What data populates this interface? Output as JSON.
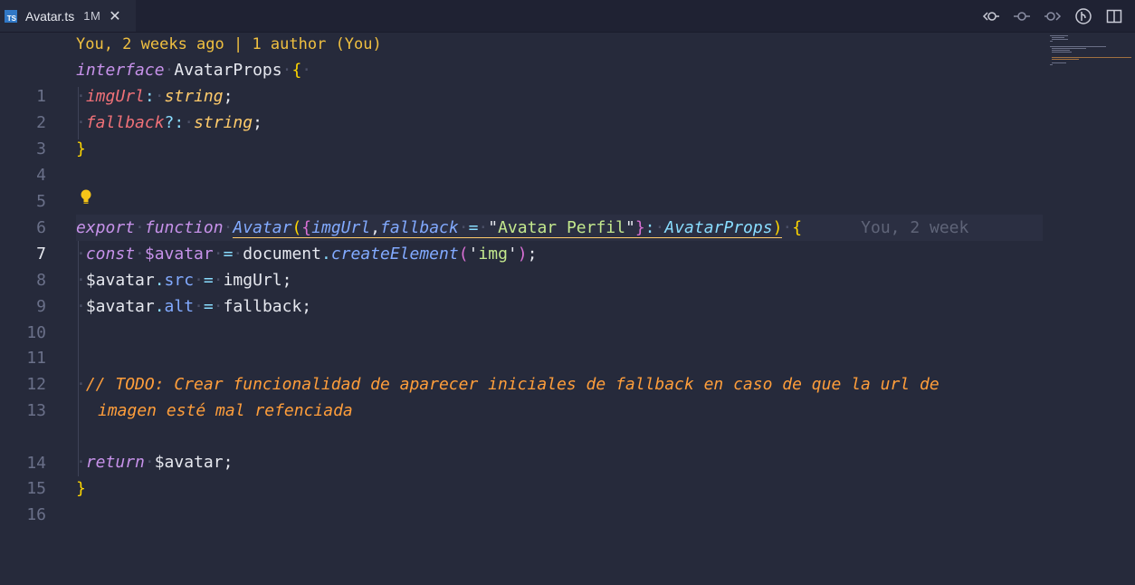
{
  "tab": {
    "icon": "typescript-file-icon",
    "icon_text": "TS",
    "filename": "Avatar.ts",
    "status": "1M",
    "close": "✕"
  },
  "toolbar": {
    "icons": [
      "git-timeline-back-icon",
      "git-commit-icon",
      "git-timeline-forward-icon",
      "git-branch-graph-icon",
      "split-editor-icon"
    ]
  },
  "codelens": "You, 2 weeks ago | 1 author (You)",
  "line_numbers": [
    "1",
    "2",
    "3",
    "4",
    "5",
    "6",
    "7",
    "8",
    "9",
    "10",
    "11",
    "12",
    "13",
    "",
    "14",
    "15",
    "16"
  ],
  "active_line": "7",
  "code": {
    "l1": [
      "interface",
      "AvatarProps",
      "{"
    ],
    "l2": [
      "imgUrl",
      ":",
      "string",
      ";"
    ],
    "l3": [
      "fallback",
      "?:",
      "string",
      ";"
    ],
    "l4": [
      "}"
    ],
    "l7": [
      "export",
      "function",
      "Avatar",
      "(",
      "{",
      "imgUrl",
      ",",
      "fallback",
      "=",
      "\"",
      "Avatar Perfil",
      "\"",
      "}",
      ":",
      "AvatarProps",
      ")",
      "{"
    ],
    "l7_blame": "You, 2 week",
    "l8": [
      "const",
      "$avatar",
      "=",
      "document",
      ".",
      "createElement",
      "(",
      "'",
      "img",
      "'",
      ")",
      ";"
    ],
    "l9": [
      "$avatar",
      ".",
      "src",
      "=",
      "imgUrl",
      ";"
    ],
    "l10": [
      "$avatar",
      ".",
      "alt",
      "=",
      "fallback",
      ";"
    ],
    "l13a": "// TODO: Crear funcionalidad de aparecer iniciales de fallback en caso de que la url de",
    "l13b": "imagen esté mal refenciada",
    "l15": [
      "return",
      "$avatar",
      ";"
    ],
    "l16": [
      "}"
    ]
  },
  "colors": {
    "background": "#262a3b",
    "keyword": "#c792ea",
    "function": "#82aaff",
    "type": "#ffcb6b",
    "string": "#c3e88d",
    "comment": "#ff9e3b",
    "bracket": "#ffd700",
    "codelens": "#f0c040"
  },
  "lightbulb_icon": "lightbulb-icon"
}
